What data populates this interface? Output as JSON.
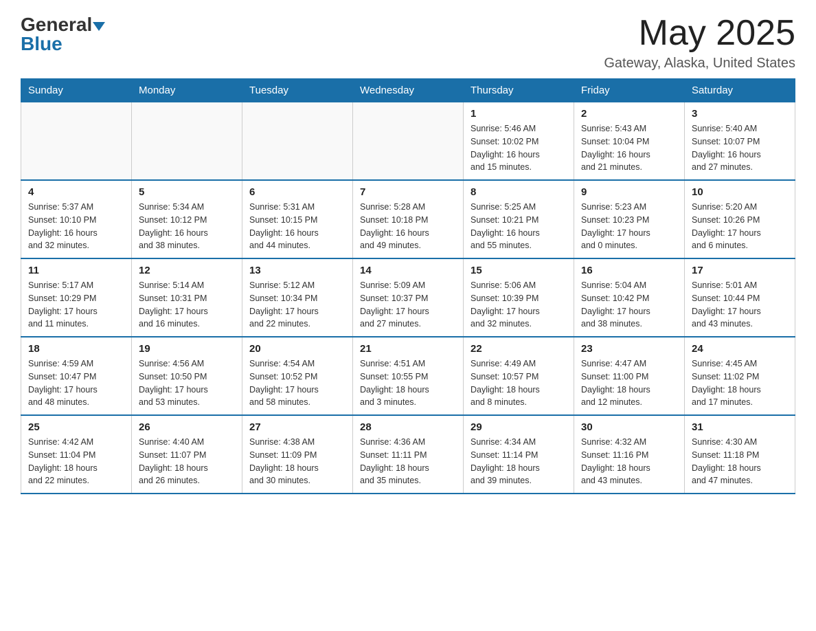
{
  "header": {
    "logo_general": "General",
    "logo_blue": "Blue",
    "month_title": "May 2025",
    "location": "Gateway, Alaska, United States"
  },
  "days_of_week": [
    "Sunday",
    "Monday",
    "Tuesday",
    "Wednesday",
    "Thursday",
    "Friday",
    "Saturday"
  ],
  "weeks": [
    [
      {
        "day": "",
        "info": ""
      },
      {
        "day": "",
        "info": ""
      },
      {
        "day": "",
        "info": ""
      },
      {
        "day": "",
        "info": ""
      },
      {
        "day": "1",
        "info": "Sunrise: 5:46 AM\nSunset: 10:02 PM\nDaylight: 16 hours\nand 15 minutes."
      },
      {
        "day": "2",
        "info": "Sunrise: 5:43 AM\nSunset: 10:04 PM\nDaylight: 16 hours\nand 21 minutes."
      },
      {
        "day": "3",
        "info": "Sunrise: 5:40 AM\nSunset: 10:07 PM\nDaylight: 16 hours\nand 27 minutes."
      }
    ],
    [
      {
        "day": "4",
        "info": "Sunrise: 5:37 AM\nSunset: 10:10 PM\nDaylight: 16 hours\nand 32 minutes."
      },
      {
        "day": "5",
        "info": "Sunrise: 5:34 AM\nSunset: 10:12 PM\nDaylight: 16 hours\nand 38 minutes."
      },
      {
        "day": "6",
        "info": "Sunrise: 5:31 AM\nSunset: 10:15 PM\nDaylight: 16 hours\nand 44 minutes."
      },
      {
        "day": "7",
        "info": "Sunrise: 5:28 AM\nSunset: 10:18 PM\nDaylight: 16 hours\nand 49 minutes."
      },
      {
        "day": "8",
        "info": "Sunrise: 5:25 AM\nSunset: 10:21 PM\nDaylight: 16 hours\nand 55 minutes."
      },
      {
        "day": "9",
        "info": "Sunrise: 5:23 AM\nSunset: 10:23 PM\nDaylight: 17 hours\nand 0 minutes."
      },
      {
        "day": "10",
        "info": "Sunrise: 5:20 AM\nSunset: 10:26 PM\nDaylight: 17 hours\nand 6 minutes."
      }
    ],
    [
      {
        "day": "11",
        "info": "Sunrise: 5:17 AM\nSunset: 10:29 PM\nDaylight: 17 hours\nand 11 minutes."
      },
      {
        "day": "12",
        "info": "Sunrise: 5:14 AM\nSunset: 10:31 PM\nDaylight: 17 hours\nand 16 minutes."
      },
      {
        "day": "13",
        "info": "Sunrise: 5:12 AM\nSunset: 10:34 PM\nDaylight: 17 hours\nand 22 minutes."
      },
      {
        "day": "14",
        "info": "Sunrise: 5:09 AM\nSunset: 10:37 PM\nDaylight: 17 hours\nand 27 minutes."
      },
      {
        "day": "15",
        "info": "Sunrise: 5:06 AM\nSunset: 10:39 PM\nDaylight: 17 hours\nand 32 minutes."
      },
      {
        "day": "16",
        "info": "Sunrise: 5:04 AM\nSunset: 10:42 PM\nDaylight: 17 hours\nand 38 minutes."
      },
      {
        "day": "17",
        "info": "Sunrise: 5:01 AM\nSunset: 10:44 PM\nDaylight: 17 hours\nand 43 minutes."
      }
    ],
    [
      {
        "day": "18",
        "info": "Sunrise: 4:59 AM\nSunset: 10:47 PM\nDaylight: 17 hours\nand 48 minutes."
      },
      {
        "day": "19",
        "info": "Sunrise: 4:56 AM\nSunset: 10:50 PM\nDaylight: 17 hours\nand 53 minutes."
      },
      {
        "day": "20",
        "info": "Sunrise: 4:54 AM\nSunset: 10:52 PM\nDaylight: 17 hours\nand 58 minutes."
      },
      {
        "day": "21",
        "info": "Sunrise: 4:51 AM\nSunset: 10:55 PM\nDaylight: 18 hours\nand 3 minutes."
      },
      {
        "day": "22",
        "info": "Sunrise: 4:49 AM\nSunset: 10:57 PM\nDaylight: 18 hours\nand 8 minutes."
      },
      {
        "day": "23",
        "info": "Sunrise: 4:47 AM\nSunset: 11:00 PM\nDaylight: 18 hours\nand 12 minutes."
      },
      {
        "day": "24",
        "info": "Sunrise: 4:45 AM\nSunset: 11:02 PM\nDaylight: 18 hours\nand 17 minutes."
      }
    ],
    [
      {
        "day": "25",
        "info": "Sunrise: 4:42 AM\nSunset: 11:04 PM\nDaylight: 18 hours\nand 22 minutes."
      },
      {
        "day": "26",
        "info": "Sunrise: 4:40 AM\nSunset: 11:07 PM\nDaylight: 18 hours\nand 26 minutes."
      },
      {
        "day": "27",
        "info": "Sunrise: 4:38 AM\nSunset: 11:09 PM\nDaylight: 18 hours\nand 30 minutes."
      },
      {
        "day": "28",
        "info": "Sunrise: 4:36 AM\nSunset: 11:11 PM\nDaylight: 18 hours\nand 35 minutes."
      },
      {
        "day": "29",
        "info": "Sunrise: 4:34 AM\nSunset: 11:14 PM\nDaylight: 18 hours\nand 39 minutes."
      },
      {
        "day": "30",
        "info": "Sunrise: 4:32 AM\nSunset: 11:16 PM\nDaylight: 18 hours\nand 43 minutes."
      },
      {
        "day": "31",
        "info": "Sunrise: 4:30 AM\nSunset: 11:18 PM\nDaylight: 18 hours\nand 47 minutes."
      }
    ]
  ]
}
